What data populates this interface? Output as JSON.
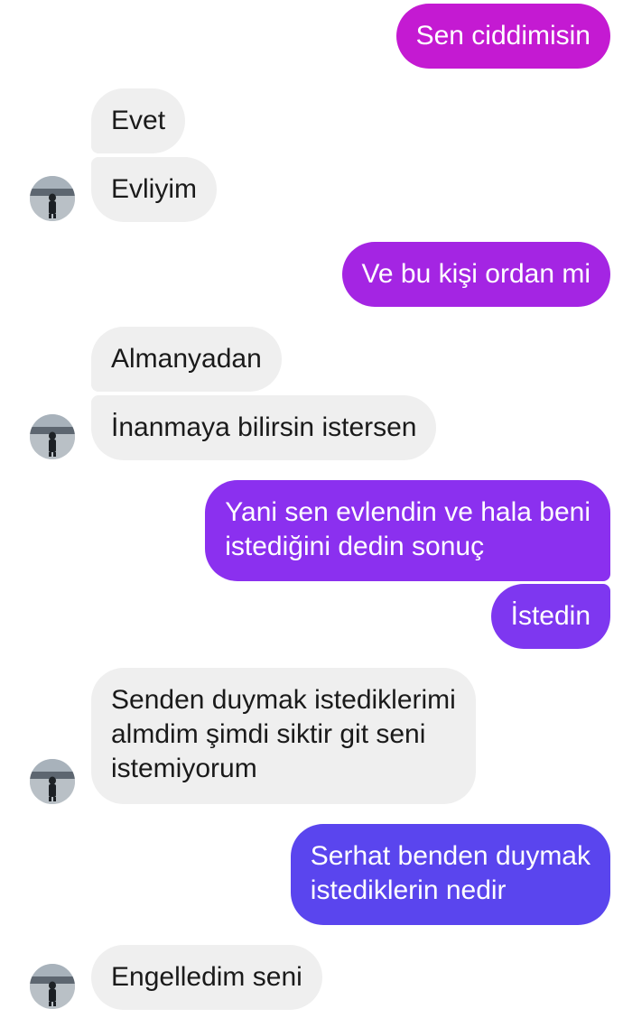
{
  "conversation": {
    "messages": [
      {
        "sender": "me",
        "text": "Sen ciddimisin"
      },
      {
        "sender": "contact",
        "text": "Evet"
      },
      {
        "sender": "contact",
        "text": "Evliyim"
      },
      {
        "sender": "me",
        "text": "Ve bu kişi ordan mi"
      },
      {
        "sender": "contact",
        "text": "Almanyadan"
      },
      {
        "sender": "contact",
        "text": "İnanmaya bilirsin istersen"
      },
      {
        "sender": "me",
        "text": "Yani sen evlendin ve hala beni\nistediğini dedin sonuç"
      },
      {
        "sender": "me",
        "text": "İstedin"
      },
      {
        "sender": "contact",
        "text": "Senden duymak istediklerimi\nalmdim şimdi siktir git seni\nistemiyorum"
      },
      {
        "sender": "me",
        "text": "Serhat benden duymak\nistediklerin nedir"
      },
      {
        "sender": "contact",
        "text": "Engelledim seni"
      }
    ]
  },
  "colors": {
    "outgoing_gradient_top": "#c41ad2",
    "outgoing_gradient_mid": "#8a2ff0",
    "outgoing_gradient_bottom": "#5048ee",
    "incoming_bubble": "#efefef",
    "incoming_text": "#1a1a1a",
    "outgoing_text": "#ffffff"
  },
  "icons": {
    "avatar": "contact-avatar-photo"
  }
}
